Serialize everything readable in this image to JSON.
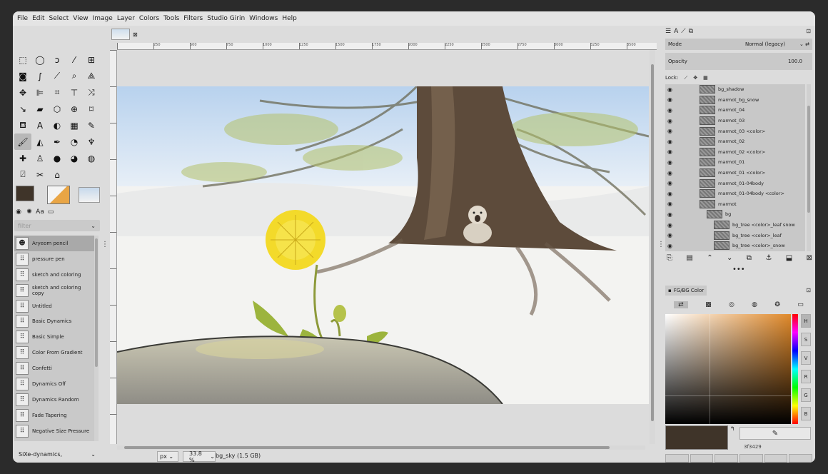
{
  "menubar": {
    "items": [
      "File",
      "Edit",
      "Select",
      "View",
      "Image",
      "Layer",
      "Colors",
      "Tools",
      "Filters",
      "Studio Girin",
      "Windows",
      "Help"
    ]
  },
  "toolbox": {
    "tools": [
      "rect-select",
      "ellipse-select",
      "free-select",
      "fuzzy-select",
      "select-by-color",
      "foreground-select",
      "paths",
      "color-picker",
      "zoom",
      "measure",
      "move",
      "align",
      "crop",
      "unified-transform",
      "warp-transform",
      "handle-transform",
      "shear",
      "perspective",
      "cage",
      "flip",
      "bucket-fill",
      "text",
      "gradient",
      "pattern",
      "pencil",
      "paintbrush",
      "eraser",
      "airbrush",
      "ink",
      "mypaint-brush",
      "heal",
      "clone",
      "smudge",
      "dodge-burn",
      "blur",
      "scissors",
      "fuzzy-select",
      "convolve",
      "perspective-clone",
      "n-point-deform"
    ],
    "filter_placeholder": "filter",
    "presets": [
      "Aryeom pencil",
      "pressure pen",
      "sketch and coloring",
      "sketch and coloring copy",
      "Untitled",
      "Basic Dynamics",
      "Basic Simple",
      "Color From Gradient",
      "Confetti",
      "Dynamics Off",
      "Dynamics Random",
      "Fade Tapering",
      "Negative Size Pressure"
    ],
    "dynamics_label": "SiXe-dynamics,"
  },
  "canvas": {
    "ruler_labels": [
      "250",
      "500",
      "750",
      "1000",
      "1250",
      "1500",
      "1750",
      "2000",
      "2250",
      "2500",
      "2750",
      "3000",
      "3250",
      "3500"
    ],
    "unit": "px",
    "zoom": "33.8 %",
    "status": "bg_sky (1.5 GB)"
  },
  "layers_panel": {
    "mode_label": "Mode",
    "mode_value": "Normal (legacy)",
    "opacity_label": "Opacity",
    "opacity_value": "100.0",
    "lock_label": "Lock:",
    "layers": [
      {
        "name": "bg_shadow",
        "indent": 0
      },
      {
        "name": "marmot_bg_snow",
        "indent": 0
      },
      {
        "name": "marmot_04",
        "indent": 0
      },
      {
        "name": "marmot_03",
        "indent": 0
      },
      {
        "name": "marmot_03 <color>",
        "indent": 0
      },
      {
        "name": "marmot_02",
        "indent": 0
      },
      {
        "name": "marmot_02 <color>",
        "indent": 0
      },
      {
        "name": "marmot_01",
        "indent": 0
      },
      {
        "name": "marmot_01 <color>",
        "indent": 0
      },
      {
        "name": "marmot_01-04body",
        "indent": 0
      },
      {
        "name": "marmot_01-04body <color>",
        "indent": 0
      },
      {
        "name": "marmot",
        "indent": 0
      },
      {
        "name": "bg",
        "indent": 1
      },
      {
        "name": "bg_tree <color>_leaf snow",
        "indent": 2
      },
      {
        "name": "bg_tree <color>_leaf",
        "indent": 2
      },
      {
        "name": "bg_tree <color>_snow",
        "indent": 2
      }
    ]
  },
  "color_panel": {
    "tab_label": "FG/BG Color",
    "channels": [
      "H",
      "S",
      "V",
      "R",
      "G",
      "B"
    ],
    "hex": "3f3429",
    "fg_color": "#3f3429"
  }
}
